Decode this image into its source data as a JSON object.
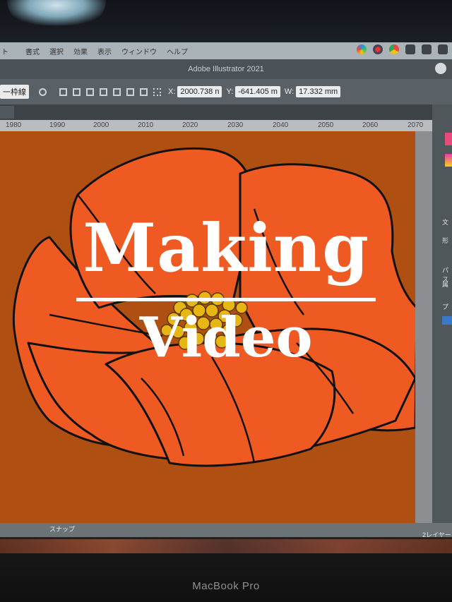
{
  "menubar": {
    "items": [
      "ト",
      "書式",
      "選択",
      "効果",
      "表示",
      "ウィンドウ",
      "ヘルプ"
    ]
  },
  "window": {
    "title": "Adobe Illustrator 2021"
  },
  "controlbar": {
    "stroke_label": "一枠線",
    "x_label": "X:",
    "x_value": "2000.738 n",
    "y_label": "Y:",
    "y_value": "-641.405 m",
    "w_label": "W:",
    "w_value": "17.332 mm"
  },
  "ruler": {
    "ticks": [
      "1980",
      "1990",
      "2000",
      "2010",
      "2020",
      "2030",
      "2040",
      "2050",
      "2060",
      "2070"
    ]
  },
  "rightpanel": {
    "items": [
      "文",
      "形",
      "パス",
      "属",
      "プ"
    ]
  },
  "statusbar": {
    "snap_label": "スナップ",
    "layers_label": "2レイヤー"
  },
  "overlay": {
    "line1": "Making",
    "line2": "Video"
  },
  "device": {
    "label": "MacBook Pro"
  },
  "colors": {
    "artboard": "#b04f12",
    "petal": "#ef5a22",
    "stamen": "#e7b514",
    "outline": "#111111"
  }
}
